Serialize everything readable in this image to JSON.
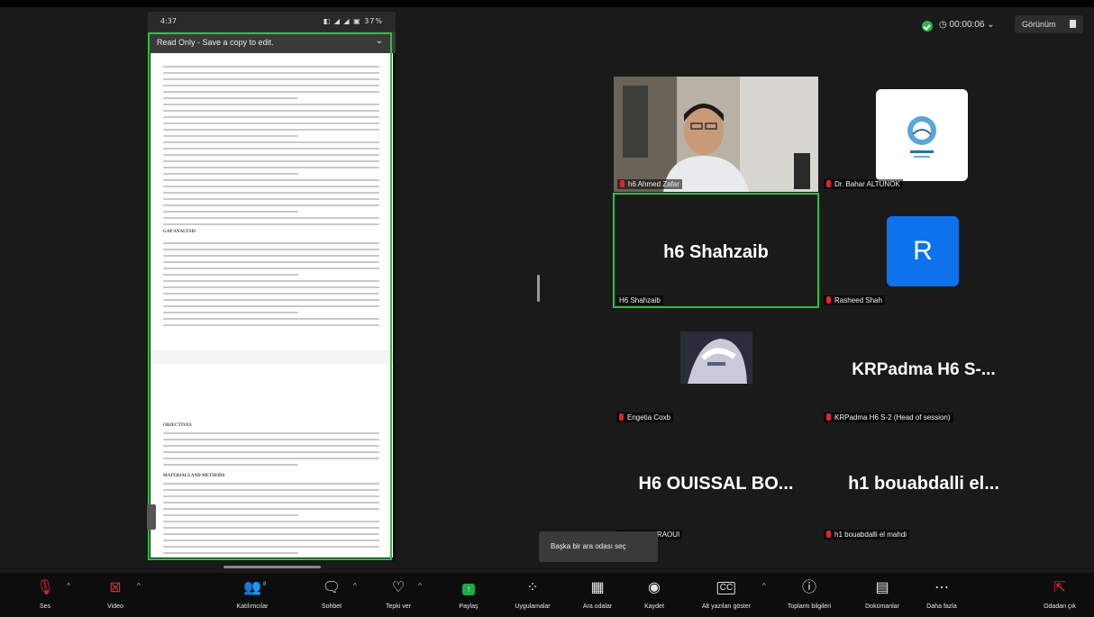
{
  "share": {
    "status_time": "4:37",
    "status_right": "◧ ◢ ◢ ▣ 37%",
    "read_only": "Read Only - Save a copy to edit.",
    "heading_gap": "GAP ANALYSIS",
    "heading_objectives": "OBJECTIVES",
    "heading_materials": "MATERIALS AND METHODS"
  },
  "topbar": {
    "timer": "00:00:06",
    "view_label": "Görünüm"
  },
  "participants": [
    {
      "name": "h6 Ahmed Zafar",
      "muted": true
    },
    {
      "name": "Dr. Bahar ALTUNOK",
      "muted": true
    },
    {
      "name": "H6 Shahzaib",
      "big": "h6 Shahzaib",
      "muted": false
    },
    {
      "name": "Rasheed Shah",
      "avatar": "R",
      "muted": true
    },
    {
      "name": "Engetia Coxb",
      "muted": true
    },
    {
      "name": "KRPadma H6 S-2 (Head of session)",
      "big": "KRPadma H6 S-...",
      "muted": true
    },
    {
      "name": "ISSAL BOURAOUI",
      "big": "H6 OUISSAL BO...",
      "muted": false
    },
    {
      "name": "h1 bouabdalli el mahdi",
      "big": "h1 bouabdalli el...",
      "muted": true
    }
  ],
  "toolbar": {
    "audio": "Ses",
    "video": "Video",
    "participants": "Katılımcılar",
    "participants_count": "8",
    "chat": "Sohbet",
    "react": "Tepki ver",
    "share": "Paylaş",
    "apps": "Uygulamalar",
    "breakout": "Ara odalar",
    "record": "Kaydet",
    "captions": "Alt yazıları göster",
    "info": "Toplantı bilgileri",
    "docs": "Dokümanlar",
    "more": "Daha fazla",
    "leave": "Odadan çık"
  },
  "tooltip": "Başka bir ara odası seç",
  "colors": {
    "accent_green": "#28c43c",
    "share_green": "#1ea94b",
    "mute_red": "#e0242b",
    "avatar_blue": "#0e72ed"
  }
}
